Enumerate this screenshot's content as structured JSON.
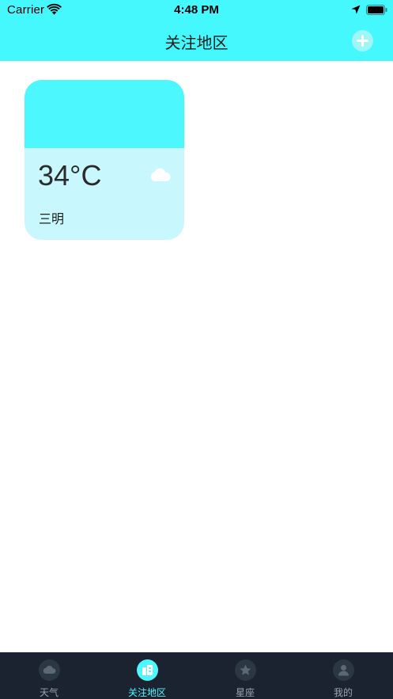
{
  "status_bar": {
    "carrier": "Carrier",
    "time": "4:48 PM"
  },
  "nav": {
    "title": "关注地区",
    "add_icon": "plus-circle-icon"
  },
  "cards": [
    {
      "temperature": "34°C",
      "city": "三明",
      "weather_icon": "cloud-icon"
    }
  ],
  "tabs": [
    {
      "label": "天气",
      "icon": "cloud-icon",
      "active": false
    },
    {
      "label": "关注地区",
      "icon": "building-icon",
      "active": true
    },
    {
      "label": "星座",
      "icon": "star-icon",
      "active": false
    },
    {
      "label": "我的",
      "icon": "user-icon",
      "active": false
    }
  ],
  "colors": {
    "header": "#44F8FE",
    "card_top": "#4DF7FE",
    "card_bottom": "#C8F7FD",
    "tabbar": "#1B2330",
    "tab_active": "#4DF7FE"
  }
}
